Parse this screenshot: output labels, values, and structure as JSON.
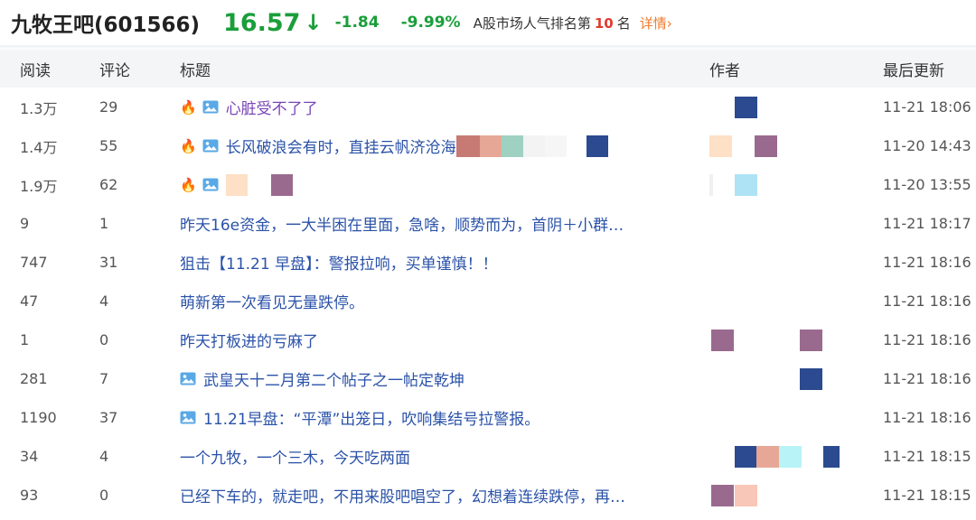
{
  "stock": {
    "name": "九牧王吧(601566)",
    "price": "16.57",
    "arrow": "↓",
    "change": "-1.84",
    "change_pct": "-9.99%",
    "rank_prefix": "A股市场人气排名第",
    "rank": "10",
    "rank_suffix": "名",
    "detail_label": "详情",
    "detail_chevron": "›",
    "colors": {
      "down": "#1a9e3a",
      "rank": "#e03a2f",
      "link": "#f07b2d",
      "title": "#2a52a8"
    }
  },
  "columns": {
    "read": "阅读",
    "comments": "评论",
    "title": "标题",
    "author": "作者",
    "updated": "最后更新"
  },
  "icons": {
    "hot": "fire-icon",
    "image": "image-icon"
  },
  "rows": [
    {
      "read": "1.3万",
      "comments": "29",
      "hot": true,
      "image": true,
      "title": "心脏受不了了",
      "visited": true,
      "time": "11-21 18:06"
    },
    {
      "read": "1.4万",
      "comments": "55",
      "hot": true,
      "image": true,
      "title": "长风破浪会有时，直挂云帆济沧海",
      "time": "11-20 14:43"
    },
    {
      "read": "1.9万",
      "comments": "62",
      "hot": true,
      "image": true,
      "title": "",
      "time": "11-20 13:55"
    },
    {
      "read": "9",
      "comments": "1",
      "title": "昨天16e资金，一大半困在里面，急啥，顺势而为，首阴＋小群…",
      "time": "11-21 18:17"
    },
    {
      "read": "747",
      "comments": "31",
      "title": "狙击【11.21 早盘】：警报拉响，买单谨慎！！",
      "time": "11-21 18:16"
    },
    {
      "read": "47",
      "comments": "4",
      "title": "萌新第一次看见无量跌停。",
      "time": "11-21 18:16"
    },
    {
      "read": "1",
      "comments": "0",
      "title": "昨天打板进的亏麻了",
      "time": "11-21 18:16"
    },
    {
      "read": "281",
      "comments": "7",
      "image": true,
      "title": "武皇天十二月第二个帖子之一帖定乾坤",
      "time": "11-21 18:16"
    },
    {
      "read": "1190",
      "comments": "37",
      "image": true,
      "title": "11.21早盘：“平潭”出笼日，吹响集结号拉警报。",
      "time": "11-21 18:16"
    },
    {
      "read": "34",
      "comments": "4",
      "title": "一个九牧，一个三木，今天吃两面",
      "time": "11-21 18:15"
    },
    {
      "read": "93",
      "comments": "0",
      "title": "已经下车的，就走吧，不用来股吧唱空了，幻想着连续跌停，再…",
      "time": "11-21 18:15"
    }
  ]
}
